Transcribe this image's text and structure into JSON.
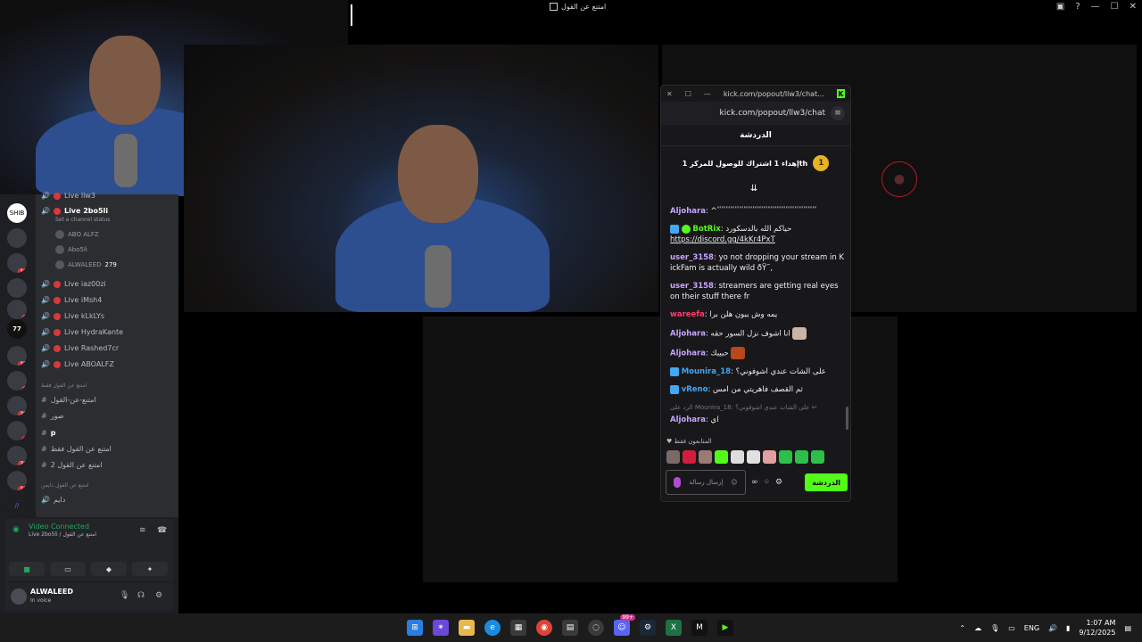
{
  "window": {
    "title": "امتنع عن القول"
  },
  "discord": {
    "servers": [
      {
        "label": "SHIB",
        "badge": ""
      },
      {
        "label": "",
        "badge": "10"
      },
      {
        "label": "",
        "badge": "7"
      },
      {
        "label": "77",
        "badge": ""
      },
      {
        "label": "",
        "badge": "15"
      },
      {
        "label": "",
        "badge": "2"
      },
      {
        "label": "",
        "badge": "20"
      },
      {
        "label": "",
        "badge": "4"
      },
      {
        "label": "",
        "badge": "76"
      },
      {
        "label": "",
        "badge": "10"
      }
    ],
    "channels_top": "Live llw3",
    "active_channel": {
      "label": "Live 2bo5li",
      "status": "Set a channel status"
    },
    "members": [
      {
        "name": "ABO ALFZ",
        "extra": ""
      },
      {
        "name": "Abo5li",
        "extra": ""
      },
      {
        "name": "ALWALEED",
        "extra": "279"
      }
    ],
    "voice_channels": [
      "Live iaz00zi",
      "Live iMsh4",
      "Live kLkLYs",
      "Live HydraKante",
      "Live Rashed7cr",
      "Live ABOALFZ"
    ],
    "category1": "امتنع عن القول فقط",
    "text_channels": [
      "امتنع-عن-القول",
      "صور",
      "p",
      "امتنع عن القول فقط",
      "امتنع عن القول 2"
    ],
    "category2": "امتنع عن القول دايمن",
    "voice_channel_bottom": "دايم",
    "voice_status": {
      "title": "Video Connected",
      "subtitle": "Live 2bo5li / امتنع عن القول"
    },
    "user": {
      "name": "ALWALEED",
      "status": "In voice"
    }
  },
  "kick": {
    "window_url": "kick.com/popout/llw3/chat...",
    "address": "kick.com/popout/llw3/chat",
    "chat_title": "الدردشة",
    "pinned": "إهداء 1 اشتراك للوصول للمركز 1th",
    "pinned_rank": "1",
    "messages": [
      {
        "user": "Aljohara",
        "color": "#c7a3ff",
        "text": "^ٴٴٴٴٴٴٴٴٴٴٴٴٴٴٴٴٴٴٴٴٴٴٴٴٴٴٴٴٴٴٴٴٴٴٴٴٴٴٴٴٴٴٴٴٴ"
      },
      {
        "user": "BotRix",
        "color": "#53fc18",
        "text": "حياكم الله بالدسكورد",
        "link": "https://discord.gg/4kKr4PxT"
      },
      {
        "user": "user_3158",
        "color": "#c7a3ff",
        "text": "yo not dropping your stream in KickFam is actually wild ðŸ˜‚"
      },
      {
        "user": "user_3158",
        "color": "#c7a3ff",
        "text": "streamers are getting real eyes on their stuff there fr"
      },
      {
        "user": "wareefa",
        "color": "#ff3b6b",
        "text": "يمه وش يبون هلن برا"
      },
      {
        "user": "Aljohara",
        "color": "#c7a3ff",
        "text": "انا اشوف نزل السور حقه"
      },
      {
        "user": "Aljohara",
        "color": "#c7a3ff",
        "text": "حبيبك"
      },
      {
        "user": "Mounira_18",
        "color": "#3fa9f5",
        "text": "على الشات عندي اشوفوني؟"
      },
      {
        "user": "vReno",
        "color": "#3fa9f5",
        "text": "ثم القصف فاهريتي من امس"
      }
    ],
    "reply_to": "الرد على Mounira_18: على الشات عندي اشوفوني؟",
    "last": {
      "user": "Aljohara",
      "color": "#c7a3ff",
      "text": "اي"
    },
    "followers_only": "المتابعون فقط",
    "input_placeholder": "إرسال رسالة",
    "send_label": "الدردشة"
  },
  "taskbar": {
    "lang": "ENG",
    "time": "1:07 AM",
    "date": "9/12/2025",
    "notify_badge": "99+"
  }
}
